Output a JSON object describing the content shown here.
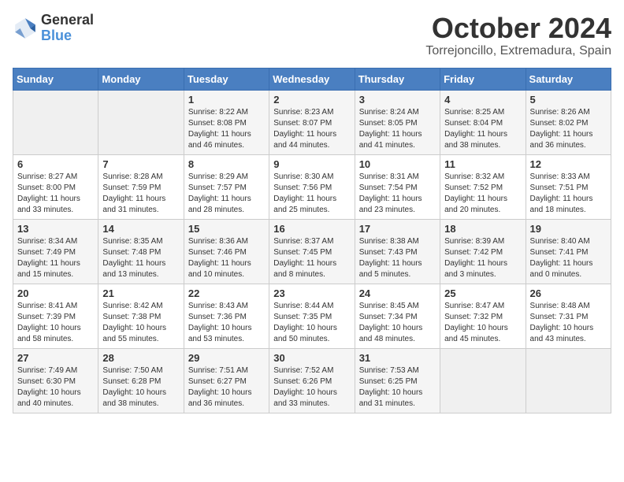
{
  "header": {
    "logo_general": "General",
    "logo_blue": "Blue",
    "month_title": "October 2024",
    "location": "Torrejoncillo, Extremadura, Spain"
  },
  "days_of_week": [
    "Sunday",
    "Monday",
    "Tuesday",
    "Wednesday",
    "Thursday",
    "Friday",
    "Saturday"
  ],
  "weeks": [
    [
      {
        "day": "",
        "sunrise": "",
        "sunset": "",
        "daylight": ""
      },
      {
        "day": "",
        "sunrise": "",
        "sunset": "",
        "daylight": ""
      },
      {
        "day": "1",
        "sunrise": "Sunrise: 8:22 AM",
        "sunset": "Sunset: 8:08 PM",
        "daylight": "Daylight: 11 hours and 46 minutes."
      },
      {
        "day": "2",
        "sunrise": "Sunrise: 8:23 AM",
        "sunset": "Sunset: 8:07 PM",
        "daylight": "Daylight: 11 hours and 44 minutes."
      },
      {
        "day": "3",
        "sunrise": "Sunrise: 8:24 AM",
        "sunset": "Sunset: 8:05 PM",
        "daylight": "Daylight: 11 hours and 41 minutes."
      },
      {
        "day": "4",
        "sunrise": "Sunrise: 8:25 AM",
        "sunset": "Sunset: 8:04 PM",
        "daylight": "Daylight: 11 hours and 38 minutes."
      },
      {
        "day": "5",
        "sunrise": "Sunrise: 8:26 AM",
        "sunset": "Sunset: 8:02 PM",
        "daylight": "Daylight: 11 hours and 36 minutes."
      }
    ],
    [
      {
        "day": "6",
        "sunrise": "Sunrise: 8:27 AM",
        "sunset": "Sunset: 8:00 PM",
        "daylight": "Daylight: 11 hours and 33 minutes."
      },
      {
        "day": "7",
        "sunrise": "Sunrise: 8:28 AM",
        "sunset": "Sunset: 7:59 PM",
        "daylight": "Daylight: 11 hours and 31 minutes."
      },
      {
        "day": "8",
        "sunrise": "Sunrise: 8:29 AM",
        "sunset": "Sunset: 7:57 PM",
        "daylight": "Daylight: 11 hours and 28 minutes."
      },
      {
        "day": "9",
        "sunrise": "Sunrise: 8:30 AM",
        "sunset": "Sunset: 7:56 PM",
        "daylight": "Daylight: 11 hours and 25 minutes."
      },
      {
        "day": "10",
        "sunrise": "Sunrise: 8:31 AM",
        "sunset": "Sunset: 7:54 PM",
        "daylight": "Daylight: 11 hours and 23 minutes."
      },
      {
        "day": "11",
        "sunrise": "Sunrise: 8:32 AM",
        "sunset": "Sunset: 7:52 PM",
        "daylight": "Daylight: 11 hours and 20 minutes."
      },
      {
        "day": "12",
        "sunrise": "Sunrise: 8:33 AM",
        "sunset": "Sunset: 7:51 PM",
        "daylight": "Daylight: 11 hours and 18 minutes."
      }
    ],
    [
      {
        "day": "13",
        "sunrise": "Sunrise: 8:34 AM",
        "sunset": "Sunset: 7:49 PM",
        "daylight": "Daylight: 11 hours and 15 minutes."
      },
      {
        "day": "14",
        "sunrise": "Sunrise: 8:35 AM",
        "sunset": "Sunset: 7:48 PM",
        "daylight": "Daylight: 11 hours and 13 minutes."
      },
      {
        "day": "15",
        "sunrise": "Sunrise: 8:36 AM",
        "sunset": "Sunset: 7:46 PM",
        "daylight": "Daylight: 11 hours and 10 minutes."
      },
      {
        "day": "16",
        "sunrise": "Sunrise: 8:37 AM",
        "sunset": "Sunset: 7:45 PM",
        "daylight": "Daylight: 11 hours and 8 minutes."
      },
      {
        "day": "17",
        "sunrise": "Sunrise: 8:38 AM",
        "sunset": "Sunset: 7:43 PM",
        "daylight": "Daylight: 11 hours and 5 minutes."
      },
      {
        "day": "18",
        "sunrise": "Sunrise: 8:39 AM",
        "sunset": "Sunset: 7:42 PM",
        "daylight": "Daylight: 11 hours and 3 minutes."
      },
      {
        "day": "19",
        "sunrise": "Sunrise: 8:40 AM",
        "sunset": "Sunset: 7:41 PM",
        "daylight": "Daylight: 11 hours and 0 minutes."
      }
    ],
    [
      {
        "day": "20",
        "sunrise": "Sunrise: 8:41 AM",
        "sunset": "Sunset: 7:39 PM",
        "daylight": "Daylight: 10 hours and 58 minutes."
      },
      {
        "day": "21",
        "sunrise": "Sunrise: 8:42 AM",
        "sunset": "Sunset: 7:38 PM",
        "daylight": "Daylight: 10 hours and 55 minutes."
      },
      {
        "day": "22",
        "sunrise": "Sunrise: 8:43 AM",
        "sunset": "Sunset: 7:36 PM",
        "daylight": "Daylight: 10 hours and 53 minutes."
      },
      {
        "day": "23",
        "sunrise": "Sunrise: 8:44 AM",
        "sunset": "Sunset: 7:35 PM",
        "daylight": "Daylight: 10 hours and 50 minutes."
      },
      {
        "day": "24",
        "sunrise": "Sunrise: 8:45 AM",
        "sunset": "Sunset: 7:34 PM",
        "daylight": "Daylight: 10 hours and 48 minutes."
      },
      {
        "day": "25",
        "sunrise": "Sunrise: 8:47 AM",
        "sunset": "Sunset: 7:32 PM",
        "daylight": "Daylight: 10 hours and 45 minutes."
      },
      {
        "day": "26",
        "sunrise": "Sunrise: 8:48 AM",
        "sunset": "Sunset: 7:31 PM",
        "daylight": "Daylight: 10 hours and 43 minutes."
      }
    ],
    [
      {
        "day": "27",
        "sunrise": "Sunrise: 7:49 AM",
        "sunset": "Sunset: 6:30 PM",
        "daylight": "Daylight: 10 hours and 40 minutes."
      },
      {
        "day": "28",
        "sunrise": "Sunrise: 7:50 AM",
        "sunset": "Sunset: 6:28 PM",
        "daylight": "Daylight: 10 hours and 38 minutes."
      },
      {
        "day": "29",
        "sunrise": "Sunrise: 7:51 AM",
        "sunset": "Sunset: 6:27 PM",
        "daylight": "Daylight: 10 hours and 36 minutes."
      },
      {
        "day": "30",
        "sunrise": "Sunrise: 7:52 AM",
        "sunset": "Sunset: 6:26 PM",
        "daylight": "Daylight: 10 hours and 33 minutes."
      },
      {
        "day": "31",
        "sunrise": "Sunrise: 7:53 AM",
        "sunset": "Sunset: 6:25 PM",
        "daylight": "Daylight: 10 hours and 31 minutes."
      },
      {
        "day": "",
        "sunrise": "",
        "sunset": "",
        "daylight": ""
      },
      {
        "day": "",
        "sunrise": "",
        "sunset": "",
        "daylight": ""
      }
    ]
  ]
}
